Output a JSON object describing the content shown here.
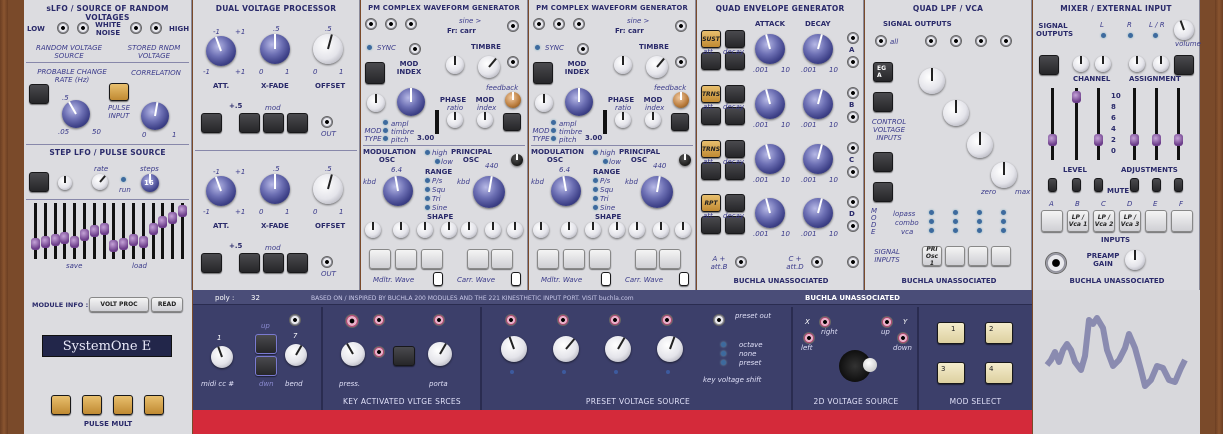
{
  "modules": {
    "slfo": {
      "title": "sLFO / SOURCE OF RANDOM VOLTAGES",
      "low": "LOW",
      "high": "HIGH",
      "white": "WHITE NOISE",
      "random": "RANDOM VOLTAGE SOURCE",
      "stored": "STORED RNDM VOLTAGE",
      "prob": "PROBABLE CHANGE RATE (Hz)",
      "corr": "CORRELATION",
      "pulse_in": "PULSE INPUT",
      "t05": ".5",
      "t05b": ".05",
      "t50": "50",
      "t0": "0",
      "t1": "1",
      "step_title": "STEP LFO / PULSE SOURCE",
      "rate": "rate",
      "run": "run",
      "steps": "steps",
      "steps_val": "16",
      "save": "save",
      "load": "load"
    },
    "dual": {
      "title": "DUAL VOLTAGE PROCESSOR",
      "att": "ATT.",
      "xfade": "X-FADE",
      "offset": "OFFSET",
      "mod": "mod",
      "out": "OUT",
      "plus5": "+.5",
      "m1": "-1",
      "p1": "+1",
      "z0": "0",
      "o1": "1",
      "h5": ".5"
    },
    "pm1": {
      "title": "PM COMPLEX WAVEFORM GENERATOR",
      "sine": "sine >",
      "fr": "Fr: carr",
      "sync": "SYNC",
      "modindex": "MOD INDEX",
      "timbre": "TIMBRE",
      "phase": "PHASE",
      "ratio": "ratio",
      "moddisp": "MOD",
      "index": "index",
      "feedback": "feedback",
      "ampl": "ampl",
      "timbre2": "timbre",
      "pitch": "pitch",
      "modtype": "MOD TYPE",
      "val": "3.00",
      "modosc": "MODULATION OSC",
      "kbd": "kbd",
      "high": "high",
      "low": "low",
      "range": "RANGE",
      "pls": "P/s",
      "squ": "Squ",
      "tri": "Tri",
      "sine2": "Sine",
      "shape": "SHAPE",
      "principal": "PRINCIPAL OSC",
      "f440": "440",
      "f64": "6.4",
      "mwave": "Mdltr. Wave",
      "cwave": "Carr. Wave"
    },
    "env": {
      "title": "QUAD ENVELOPE GENERATOR",
      "attack": "ATTACK",
      "decay": "DECAY",
      "sust": "SUST",
      "trns": "TRNS",
      "rpt": "RPT",
      "att": "att.",
      "dec": "decay",
      "a": "A",
      "b": "B",
      "c": "C",
      "d": "D",
      "ab": "A + att.B",
      "cd": "C + att.D",
      "r001": ".001",
      "r10": "10",
      "footer": "BUCHLA UNASSOCIATED"
    },
    "lpf": {
      "title": "QUAD LPF / VCA",
      "outs": "SIGNAL OUTPUTS",
      "all": "all",
      "ega": "EG A",
      "cv": "CONTROL VOLTAGE INPUTS",
      "zero": "zero",
      "max": "max",
      "mode": "M O D E",
      "lopass": "lopass",
      "combo": "combo",
      "vca": "vca",
      "sig_in": "SIGNAL INPUTS",
      "pri": "PRI Osc 1",
      "footer": "BUCHLA UNASSOCIATED"
    },
    "mixer": {
      "title": "MIXER / EXTERNAL INPUT",
      "outs": "SIGNAL OUTPUTS",
      "l": "L",
      "r": "R",
      "lr": "L / R",
      "volume": "volume",
      "channel": "CHANNEL",
      "assign": "ASSIGNMENT",
      "scale": [
        "10",
        "8",
        "6",
        "4",
        "2",
        "0"
      ],
      "level": "LEVEL",
      "adjust": "ADJUSTMENTS",
      "mute": "MUTE",
      "inputs": "INPUTS",
      "chans": [
        "A",
        "B",
        "C",
        "D",
        "E",
        "F"
      ],
      "lp1": "LP / Vca 1",
      "lp2": "LP / Vca 2",
      "lp3": "LP / Vca 3",
      "preamp": "PREAMP GAIN",
      "footer": "BUCHLA UNASSOCIATED"
    }
  },
  "bar": {
    "poly": "poly :",
    "poly_val": "32",
    "based": "BASED ON / INSPIRED BY BUCHLA 200 MODULES AND THE 221 KINESTHETIC INPUT PORT.  VISIT buchla.com",
    "brand": "BUCHLA    UNASSOCIATED"
  },
  "left": {
    "modinfo": "MODULE INFO :",
    "volt": "VOLT PROC",
    "read": "READ",
    "name": "SystemOne E",
    "pulse": "PULSE MULT"
  },
  "kbd": {
    "up": "up",
    "dwn": "dwn",
    "midi": "midi cc #",
    "bend": "bend",
    "one": "1",
    "seven": "7",
    "press": "press.",
    "porta": "porta",
    "kavs": "KEY  ACTIVATED  VLTGE  SRCES",
    "preset_out": "preset out",
    "octave": "octave",
    "none": "none",
    "preset": "preset",
    "kvs": "key  voltage  shift",
    "pvs": "PRESET  VOLTAGE  SOURCE",
    "x": "X",
    "y": "Y",
    "right": "right",
    "left": "left",
    "up2": "up",
    "down": "down",
    "vs2d": "2D  VOLTAGE  SOURCE",
    "modsel": "MOD  SELECT",
    "m1": "1",
    "m2": "2",
    "m3": "3",
    "m4": "4"
  }
}
